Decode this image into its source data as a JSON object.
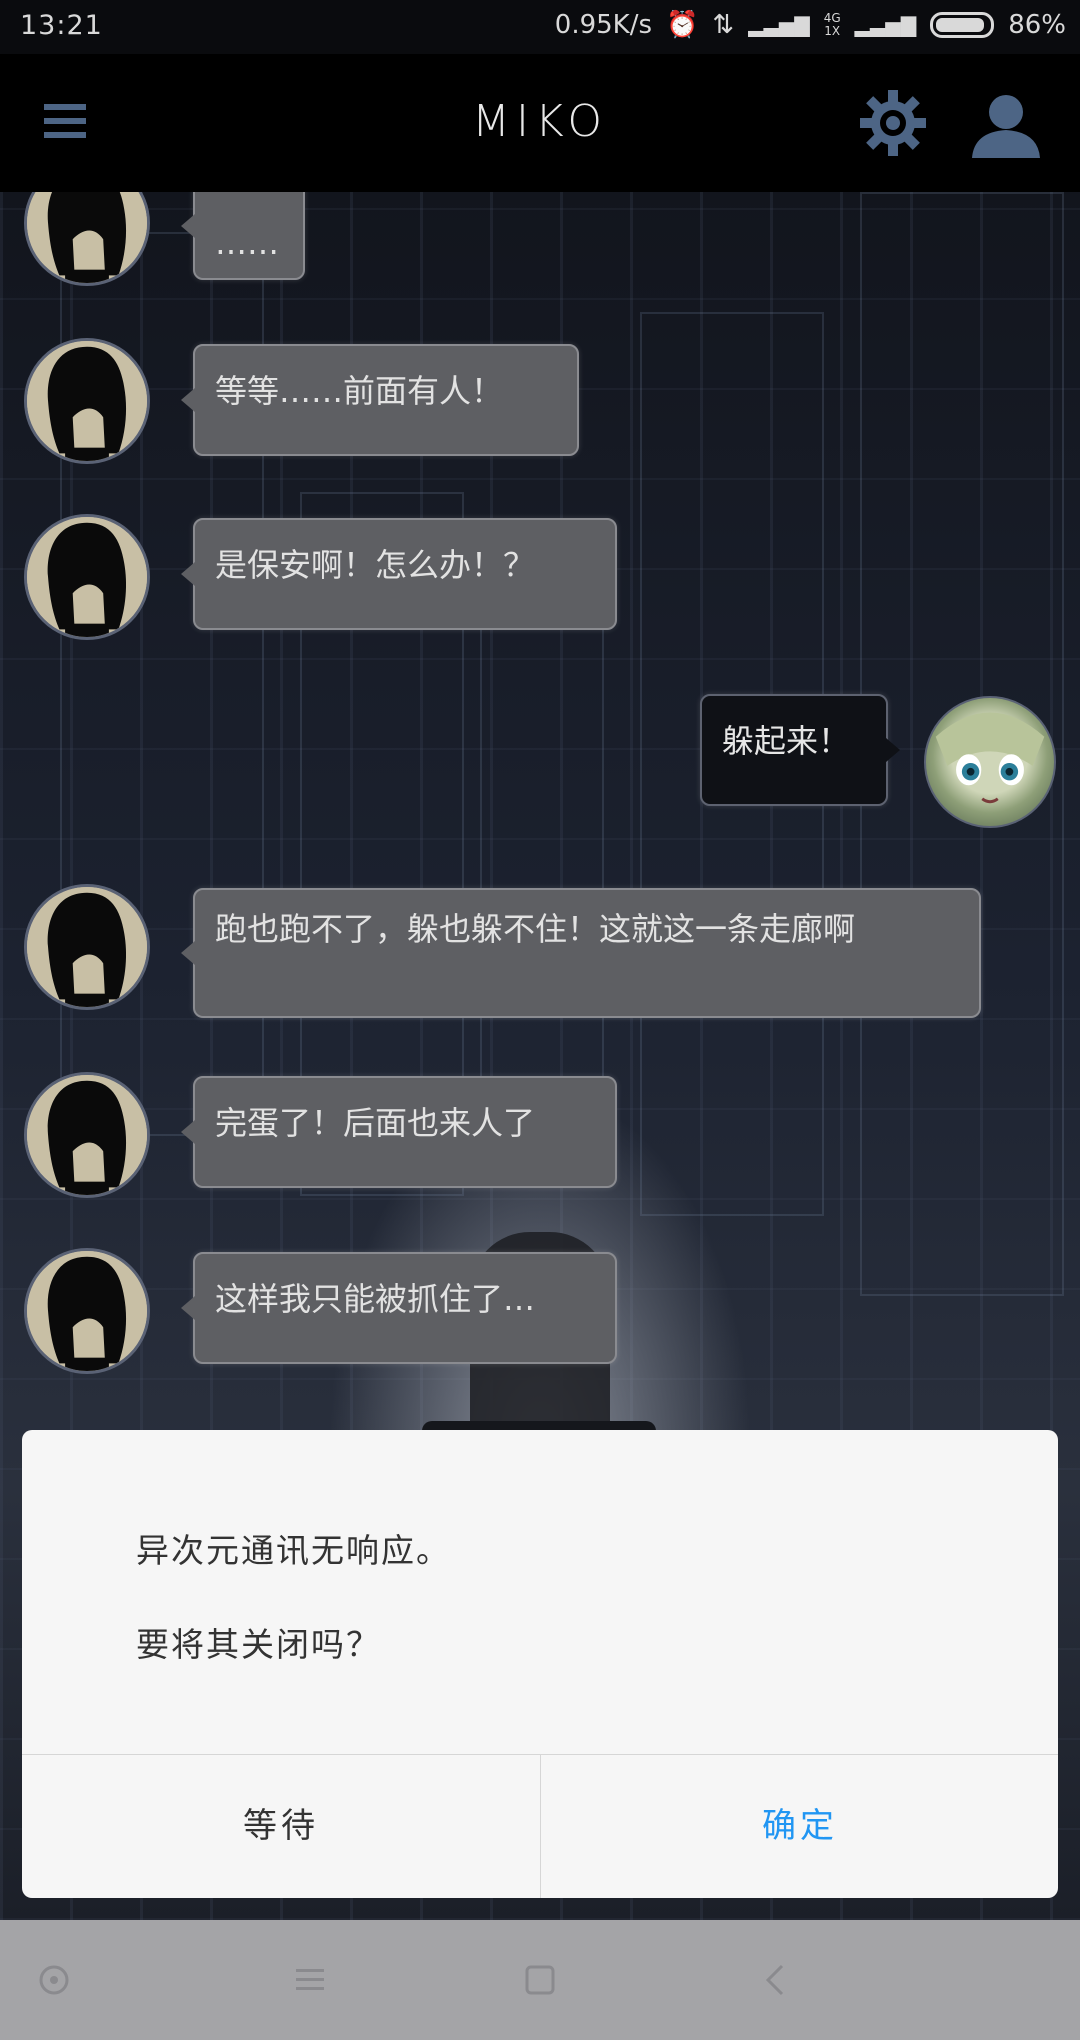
{
  "status_bar": {
    "time": "13:21",
    "network_speed": "0.95K/s",
    "signal_4g_top": "4G",
    "signal_4g_bottom": "1X",
    "battery_percent": "86%"
  },
  "app_bar": {
    "title": "MIKO",
    "menu_icon": "menu-icon",
    "settings_icon": "gear-icon",
    "profile_icon": "user-icon",
    "accent_color": "#4d6585"
  },
  "messages": [
    {
      "side": "left",
      "text": "……"
    },
    {
      "side": "left",
      "text": "等等……前面有人！"
    },
    {
      "side": "left",
      "text": "是保安啊！怎么办！？"
    },
    {
      "side": "right",
      "text": "躲起来！"
    },
    {
      "side": "left",
      "text": "跑也跑不了，躲也躲不住！这就这一条走廊啊"
    },
    {
      "side": "left",
      "text": "完蛋了！后面也来人了"
    },
    {
      "side": "left",
      "text": "这样我只能被抓住了…"
    }
  ],
  "dialog": {
    "line1": "异次元通讯无响应。",
    "line2": "要将其关闭吗？",
    "wait_label": "等待",
    "confirm_label": "确定",
    "confirm_color": "#2196f3"
  },
  "nav_bar": {
    "icons": [
      "assistant-dot-icon",
      "menu-lines-icon",
      "home-square-icon",
      "back-chevron-icon"
    ]
  }
}
